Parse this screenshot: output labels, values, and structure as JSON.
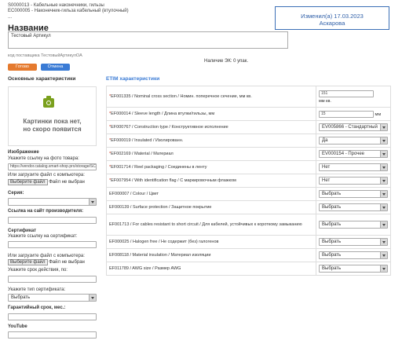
{
  "breadcrumb": {
    "line1": "S0000013 - Кабельные наконечники, гильзы",
    "line2": "EC000005 - Наконечник-гильза кабельный (втулочный)",
    "line3": "..."
  },
  "changed_box": {
    "line1": "Изменил(а) 17.03.2023",
    "line2": "Аскарова"
  },
  "title_section": {
    "heading": "Название",
    "value": "Тестовый Артикул"
  },
  "supplier_code": "код поставщика ТестовыйАртикулОА",
  "stock": "Наличие ЭК: 0 упак.",
  "buttons": {
    "save": "Готово",
    "cancel": "Отмена"
  },
  "left": {
    "main_title": "Основные характеристики",
    "placeholder_line1": "Картинки пока нет,",
    "placeholder_line2": "но скоро появится",
    "image_title": "Изображение",
    "image_link_label": "Укажите ссылку на фото товара:",
    "image_link_value": "https://vendor.catalog.smart-shop.pro/storage/SC",
    "upload_label": "Или загрузите файл с компьютера:",
    "file_button": "Выберите файл",
    "file_none": "Файл не выбран",
    "series_label": "Серия:",
    "manufacturer_link_label": "Ссылка на сайт производителя:",
    "cert_title": "Сертификат",
    "cert_link_label": "Укажите ссылку на сертификат:",
    "cert_upload_label": "Или загрузите файл с компьютера:",
    "cert_validity_label": "Укажите срок действия, по:",
    "cert_type_label": "Укажите тип сертификата:",
    "cert_type_value": "Выбрать",
    "warranty_label": "Гарантийный срок, мес.:",
    "youtube_label": "YouTube"
  },
  "etim": {
    "title": "ETIM характеристики",
    "rows": [
      {
        "label": "EF001335 / Nominal cross section / Номин. поперечное сечение, мм кв.",
        "required": true,
        "value": "151",
        "unit": "мм кв.",
        "kind": "input-under"
      },
      {
        "label": "EF000014 / Sleeve length / Длина втулки/гильзы, мм",
        "required": true,
        "value": "15",
        "unit": "мм",
        "kind": "input-side"
      },
      {
        "label": "EF000767 / Construction type / Конструктивное исполнение",
        "required": true,
        "value": "EV005866 - Стандартный",
        "kind": "select"
      },
      {
        "label": "EF000019 / Insulated / Изолированн.",
        "required": true,
        "value": "Да",
        "kind": "select"
      },
      {
        "label": "EF002169 / Material / Материал",
        "required": true,
        "value": "EV000154 - Прочее",
        "kind": "select"
      },
      {
        "label": "EF001714 / Reel packaging / Соединены в ленту",
        "required": true,
        "value": "Нет",
        "kind": "select"
      },
      {
        "label": "EF007954 / With identification flag / С маркировочным флажком",
        "required": true,
        "value": "Нет",
        "kind": "select"
      },
      {
        "label": "EF000007 / Colour / Цвет",
        "required": false,
        "value": "Выбрать",
        "kind": "select"
      },
      {
        "label": "EF000139 / Surface protection / Защитное покрытие",
        "required": false,
        "value": "Выбрать",
        "kind": "select"
      },
      {
        "label": "EF001713 / For cables resistant to short circuit / Для кабелей, устойчивых к короткому замыканию",
        "required": false,
        "value": "Выбрать",
        "kind": "select"
      },
      {
        "label": "EF000025 / Halogen free / Не содержит (без) галогенов",
        "required": false,
        "value": "Выбрать",
        "kind": "select"
      },
      {
        "label": "EF008118 / Material insulation / Материал изоляции",
        "required": false,
        "value": "Выбрать",
        "kind": "select"
      },
      {
        "label": "EF011789 / AWG size / Размер AWG",
        "required": false,
        "value": "Выбрать",
        "kind": "select"
      }
    ]
  }
}
